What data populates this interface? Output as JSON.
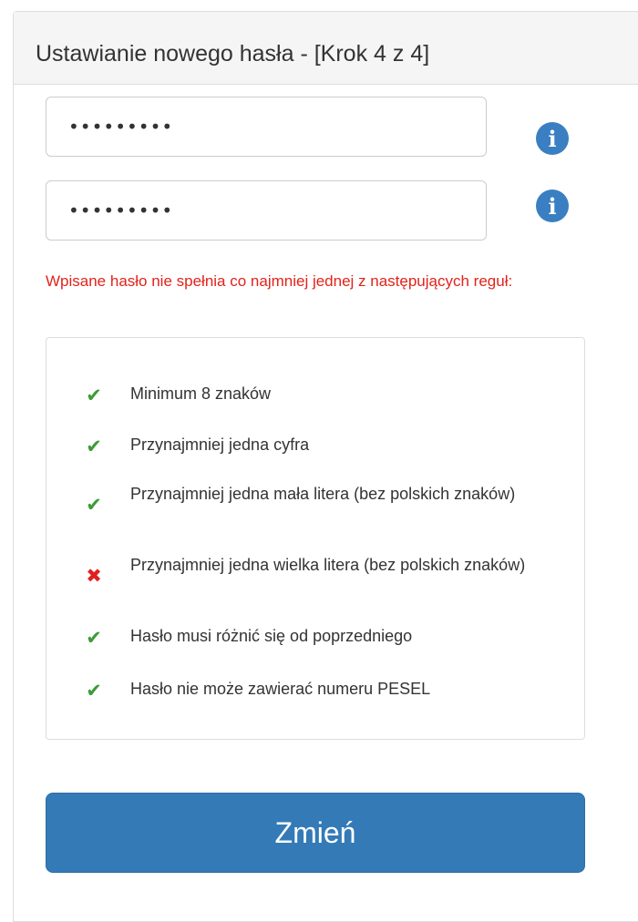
{
  "panel": {
    "title": "Ustawianie nowego hasła - [Krok 4 z 4]"
  },
  "form": {
    "password_masked": "•••••••••",
    "password_confirm_masked": "•••••••••",
    "info_icon_glyph": "i",
    "info_icon_color": "#3a7fc1"
  },
  "error": {
    "message": "Wpisane hasło nie spełnia co najmniej jednej z następujących reguł:",
    "color": "#e2231a"
  },
  "rules": [
    {
      "label": "Minimum 8 znaków",
      "status": "ok",
      "glyph": "✔"
    },
    {
      "label": "Przynajmniej jedna cyfra",
      "status": "ok",
      "glyph": "✔"
    },
    {
      "label": "Przynajmniej jedna mała litera (bez polskich znaków)",
      "status": "ok",
      "glyph": "✔"
    },
    {
      "label": "Przynajmniej jedna wielka litera (bez polskich znaków)",
      "status": "bad",
      "glyph": "✖"
    },
    {
      "label": "Hasło musi różnić się od poprzedniego",
      "status": "ok",
      "glyph": "✔"
    },
    {
      "label": "Hasło nie może zawierać numeru PESEL",
      "status": "ok",
      "glyph": "✔"
    }
  ],
  "submit": {
    "label": "Zmień",
    "color": "#337ab7"
  }
}
